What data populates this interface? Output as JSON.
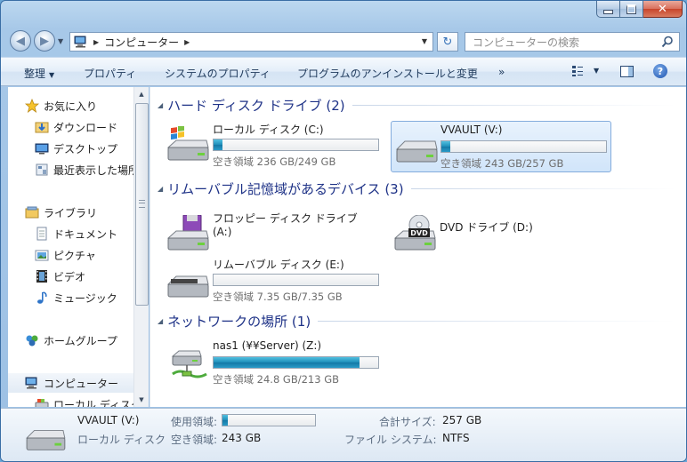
{
  "window": {
    "close_glyph": "✕"
  },
  "nav": {
    "back_glyph": "◀",
    "forward_glyph": "▶",
    "breadcrumb": "コンピューター",
    "refresh_glyph": "↻",
    "search_placeholder": "コンピューターの検索"
  },
  "toolbar": {
    "organize": "整理",
    "properties": "プロパティ",
    "system_properties": "システムのプロパティ",
    "uninstall": "プログラムのアンインストールと変更",
    "more": "»",
    "help": "?"
  },
  "sidebar": {
    "items": [
      {
        "label": "お気に入り",
        "icon": "star-icon"
      },
      {
        "label": "ダウンロード",
        "icon": "downloads-folder-icon"
      },
      {
        "label": "デスクトップ",
        "icon": "desktop-icon"
      },
      {
        "label": "最近表示した場所",
        "icon": "recent-places-icon"
      },
      {
        "label": "ライブラリ",
        "icon": "library-icon"
      },
      {
        "label": "ドキュメント",
        "icon": "documents-icon"
      },
      {
        "label": "ピクチャ",
        "icon": "pictures-icon"
      },
      {
        "label": "ビデオ",
        "icon": "videos-icon"
      },
      {
        "label": "ミュージック",
        "icon": "music-icon"
      },
      {
        "label": "ホームグループ",
        "icon": "homegroup-icon"
      },
      {
        "label": "コンピューター",
        "icon": "computer-icon"
      },
      {
        "label": "ローカル ディスク",
        "icon": "local-disk-icon"
      }
    ]
  },
  "groups": {
    "hard_disks": "ハード ディスク ドライブ (2)",
    "removable": "リムーバブル記憶域があるデバイス (3)",
    "network": "ネットワークの場所 (1)"
  },
  "drives": {
    "c": {
      "name": "ローカル ディスク (C:)",
      "free": "空き領域 236 GB/249 GB",
      "used_fraction": 0.052
    },
    "v": {
      "name": "VVAULT (V:)",
      "free": "空き領域 243 GB/257 GB",
      "used_fraction": 0.054
    },
    "a": {
      "name": "フロッピー ディスク ドライブ",
      "name2": "(A:)"
    },
    "d": {
      "name": "DVD ドライブ (D:)",
      "dvd_text": "DVD"
    },
    "e": {
      "name": "リムーバブル ディスク (E:)",
      "free": "空き領域 7.35 GB/7.35 GB",
      "used_fraction": 0.0
    },
    "z": {
      "name": "nas1 (¥¥Server) (Z:)",
      "free": "空き領域 24.8 GB/213 GB",
      "used_fraction": 0.884
    }
  },
  "details": {
    "name": "VVAULT (V:)",
    "type": "ローカル ディスク",
    "used_label": "使用領域:",
    "used_fraction": 0.054,
    "free_label": "空き領域:",
    "free_value": "243 GB",
    "total_label": "合計サイズ:",
    "total_value": "257 GB",
    "fs_label": "ファイル システム:",
    "fs_value": "NTFS"
  }
}
